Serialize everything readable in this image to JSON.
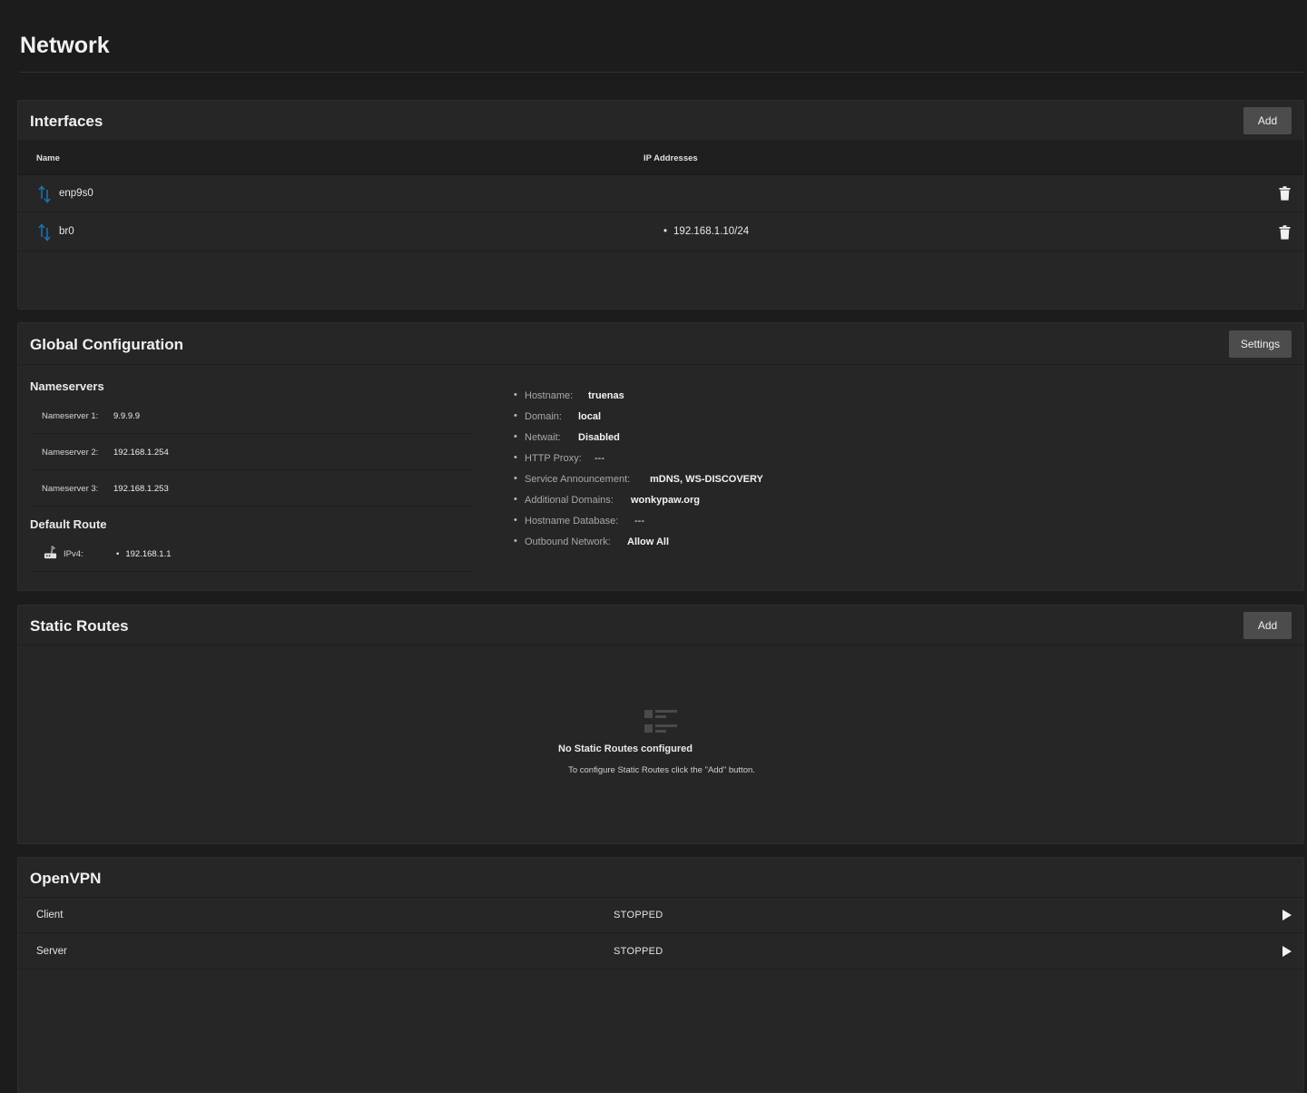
{
  "page": {
    "title": "Network"
  },
  "interfaces": {
    "title": "Interfaces",
    "add_label": "Add",
    "columns": {
      "name": "Name",
      "ip": "IP Addresses"
    },
    "rows": [
      {
        "name": "enp9s0",
        "ip": "",
        "bullet": ""
      },
      {
        "name": "br0",
        "ip": "192.168.1.10/24",
        "bullet": "•"
      }
    ],
    "icon": "network-interface-icon",
    "accent": "#1e6fa8"
  },
  "global": {
    "title": "Global Configuration",
    "settings_label": "Settings",
    "nameservers_title": "Nameservers",
    "nameservers": [
      {
        "label": "Nameserver 1:",
        "value": "9.9.9.9"
      },
      {
        "label": "Nameserver 2:",
        "value": "192.168.1.254"
      },
      {
        "label": "Nameserver 3:",
        "value": "192.168.1.253"
      }
    ],
    "default_route_title": "Default Route",
    "default_route": {
      "label": "IPv4:",
      "value": "192.168.1.1",
      "bullet": "•"
    },
    "bullet": "•",
    "details": [
      {
        "label": "Hostname:",
        "value": "truenas"
      },
      {
        "label": "Domain:",
        "value": "local"
      },
      {
        "label": "Netwait:",
        "value": "Disabled"
      },
      {
        "label": "HTTP Proxy:",
        "value": "---"
      },
      {
        "label": "Service Announcement:",
        "value": "mDNS, WS-DISCOVERY"
      },
      {
        "label": "Additional Domains:",
        "value": "wonkypaw.org"
      },
      {
        "label": "Hostname Database:",
        "value": "---"
      },
      {
        "label": "Outbound Network:",
        "value": "Allow All"
      }
    ]
  },
  "static_routes": {
    "title": "Static Routes",
    "add_label": "Add",
    "empty_title": "No Static Routes configured",
    "empty_message": "To configure Static Routes click the \"Add\" button."
  },
  "openvpn": {
    "title": "OpenVPN",
    "rows": [
      {
        "name": "Client",
        "status": "STOPPED"
      },
      {
        "name": "Server",
        "status": "STOPPED"
      }
    ]
  }
}
